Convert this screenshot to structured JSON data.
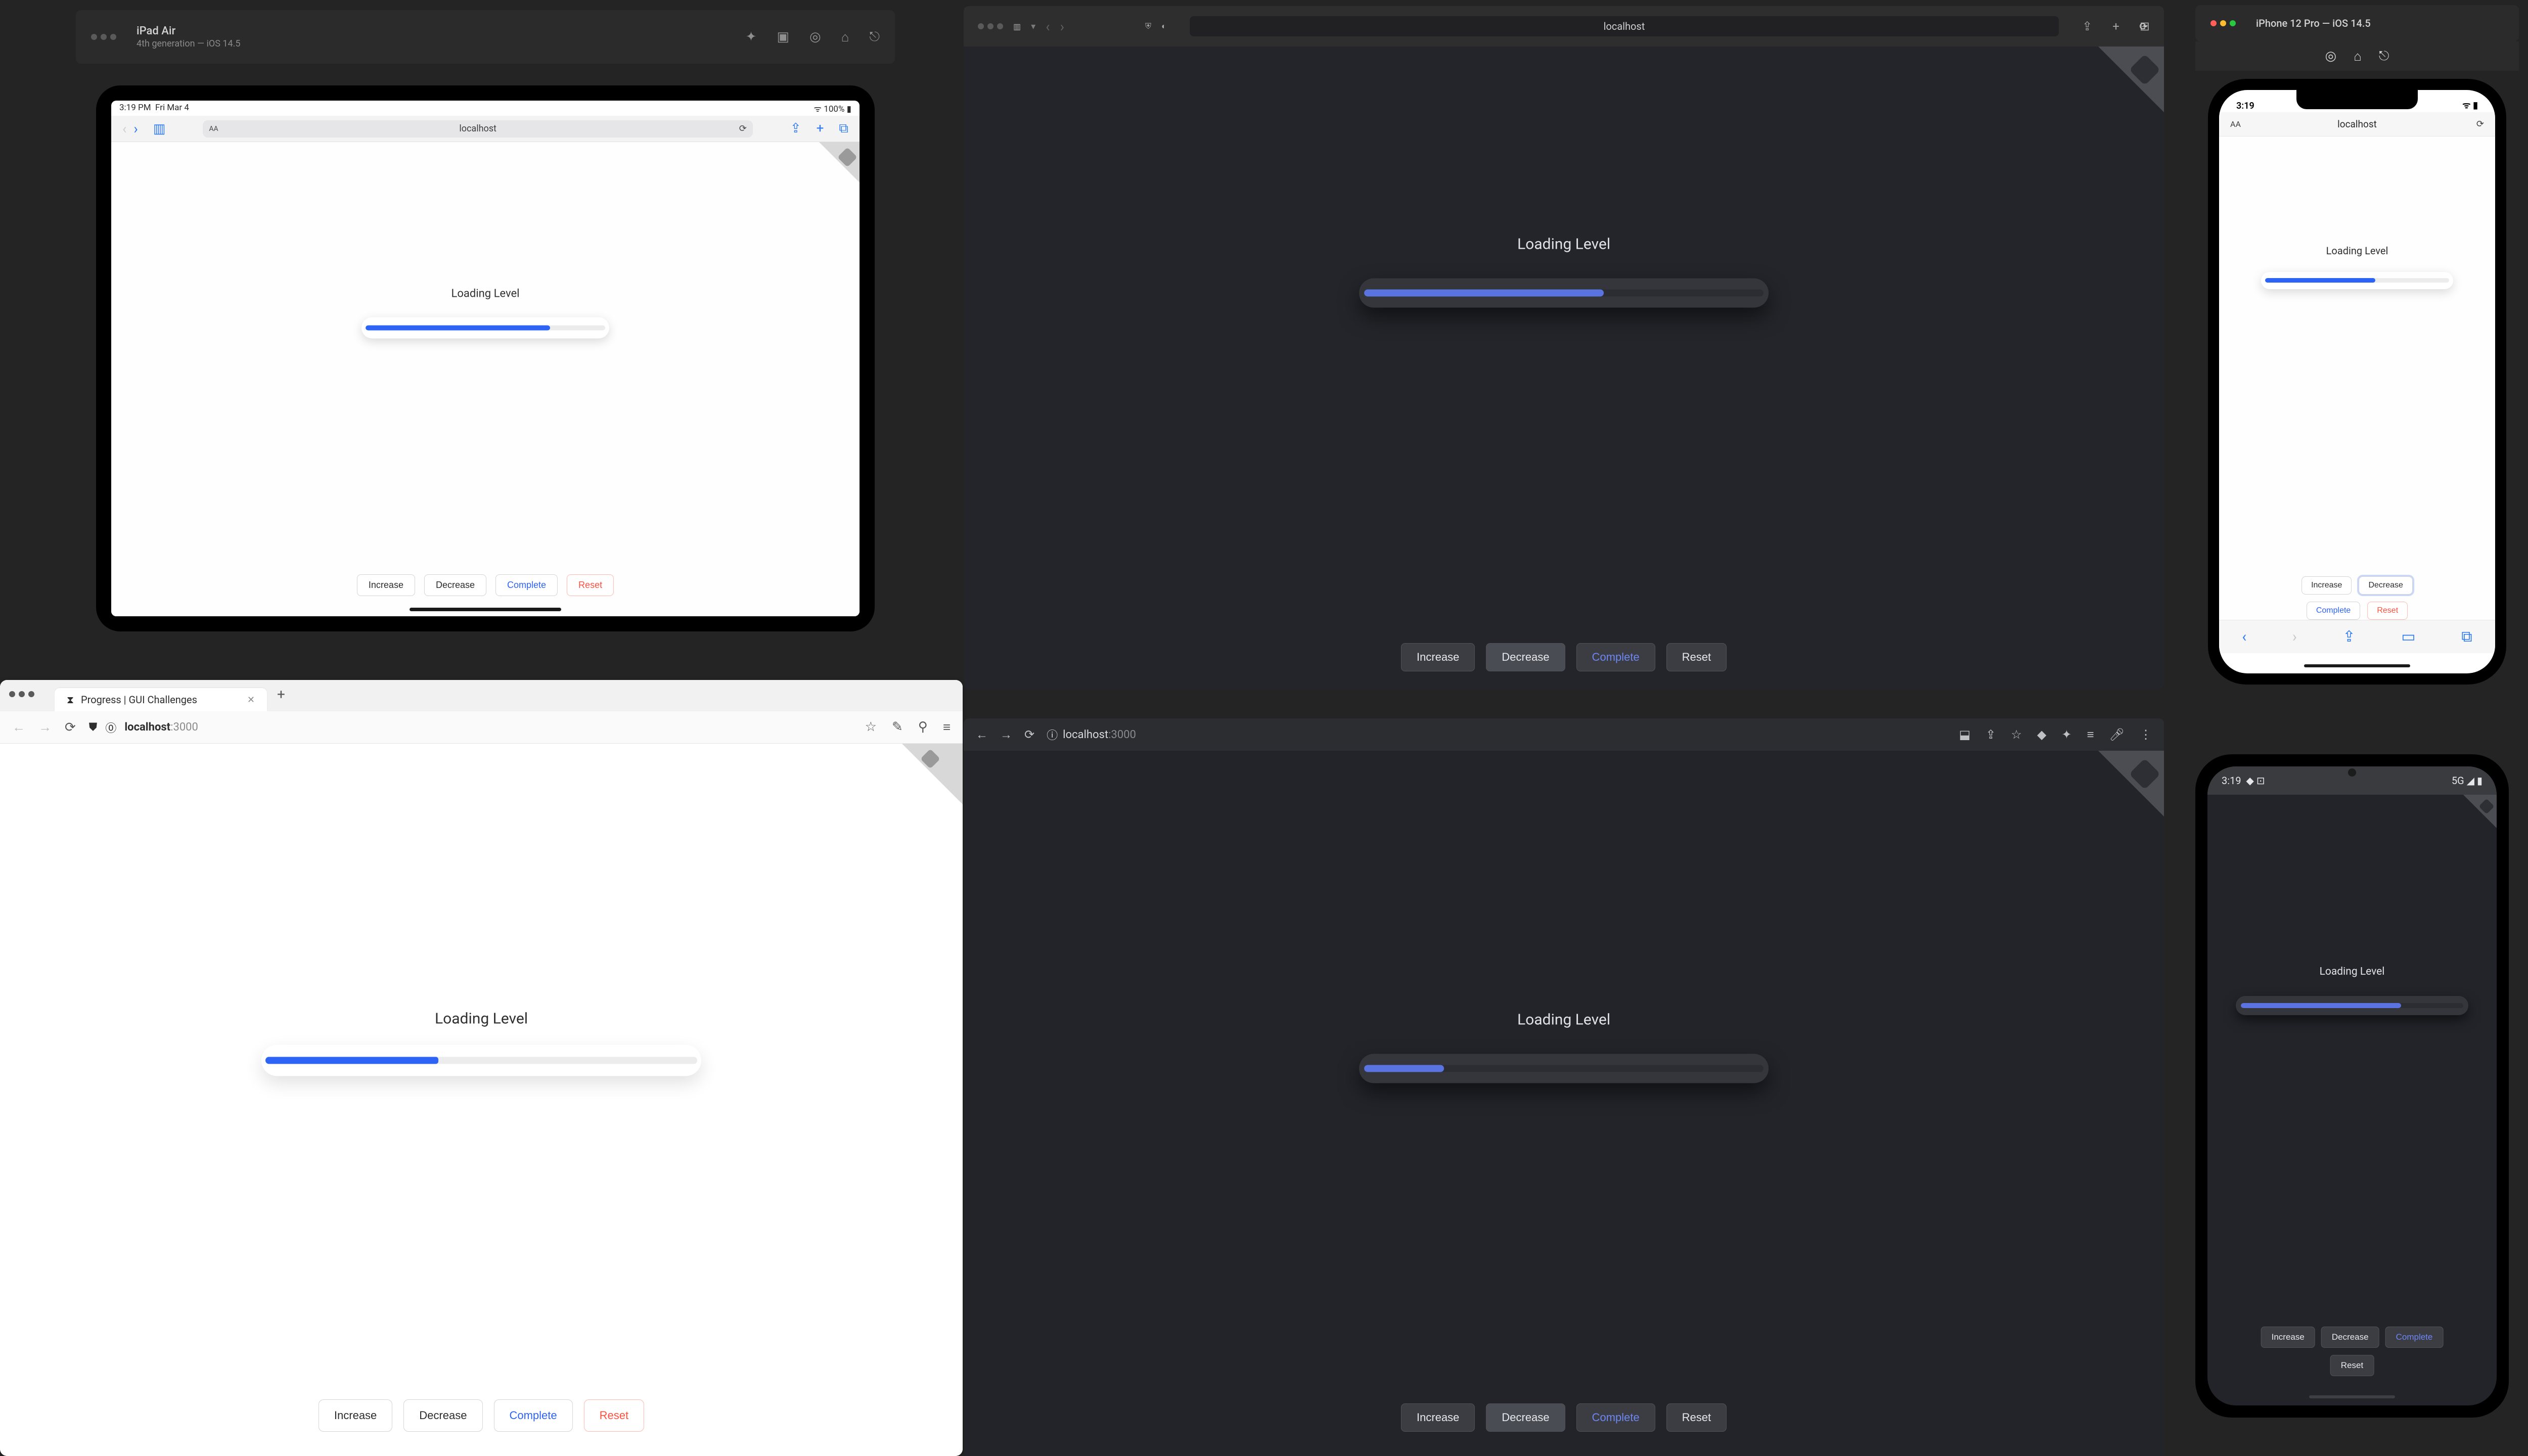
{
  "demo": {
    "heading": "Loading Level",
    "buttons": {
      "increase": "Increase",
      "decrease": "Decrease",
      "complete": "Complete",
      "reset": "Reset"
    }
  },
  "ipad_sim": {
    "title": "iPad Air",
    "subtitle": "4th generation — iOS 14.5",
    "status": {
      "time": "3:19 PM",
      "date": "Fri Mar 4",
      "wifi": "100%"
    },
    "url_label": "localhost",
    "text_size": "AA",
    "progress_percent": 77
  },
  "iphone_sim": {
    "title": "iPhone 12 Pro — iOS 14.5",
    "status_time": "3:19",
    "url_label": "localhost",
    "text_size": "AA",
    "progress_percent": 60
  },
  "safari_desktop": {
    "url_label": "localhost",
    "progress_percent": 60
  },
  "firefox": {
    "tab_title": "Progress | GUI Challenges",
    "url_host": "localhost",
    "url_port": ":3000",
    "progress_percent": 40
  },
  "chrome": {
    "url_host": "localhost",
    "url_port": ":3000",
    "progress_percent": 20
  },
  "android": {
    "status_time": "3:19",
    "status_net": "5G",
    "progress_percent": 72
  },
  "colors": {
    "accent_light": "#2d64f6",
    "accent_dark": "#5a73e0",
    "danger": "#ff4f3d"
  }
}
